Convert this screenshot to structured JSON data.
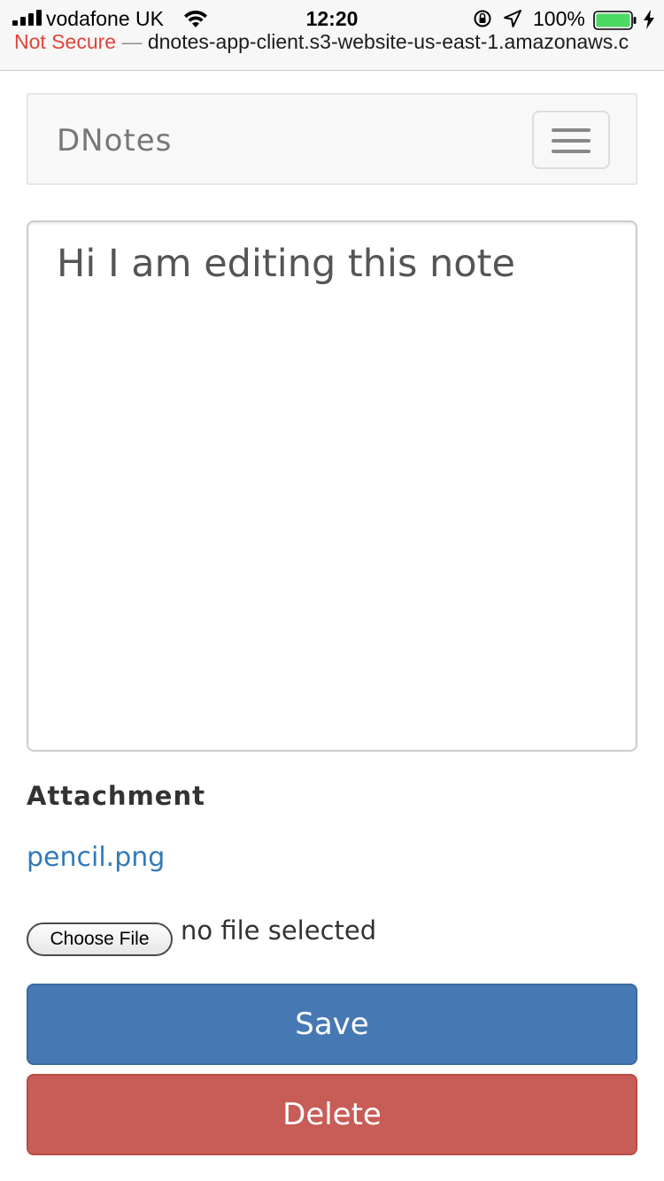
{
  "status_bar": {
    "carrier": "vodafone UK",
    "time": "12:20",
    "battery": "100%",
    "battery_level": 1.0
  },
  "url_bar": {
    "security": "Not Secure",
    "separator": " — ",
    "url": "dnotes-app-client.s3-website-us-east-1.amazonaws.c"
  },
  "navbar": {
    "brand": "DNotes"
  },
  "editor": {
    "content": "Hi I am editing this note"
  },
  "attachment": {
    "label": "Attachment",
    "file_link": "pencil.png"
  },
  "file_input": {
    "button_label": "Choose File",
    "status": "no file selected"
  },
  "actions": {
    "save_label": "Save",
    "delete_label": "Delete"
  },
  "colors": {
    "primary": "#4679b4",
    "danger": "#c85c57",
    "link": "#337ab7",
    "not_secure": "#e0443a",
    "battery_fill": "#4cd964"
  }
}
